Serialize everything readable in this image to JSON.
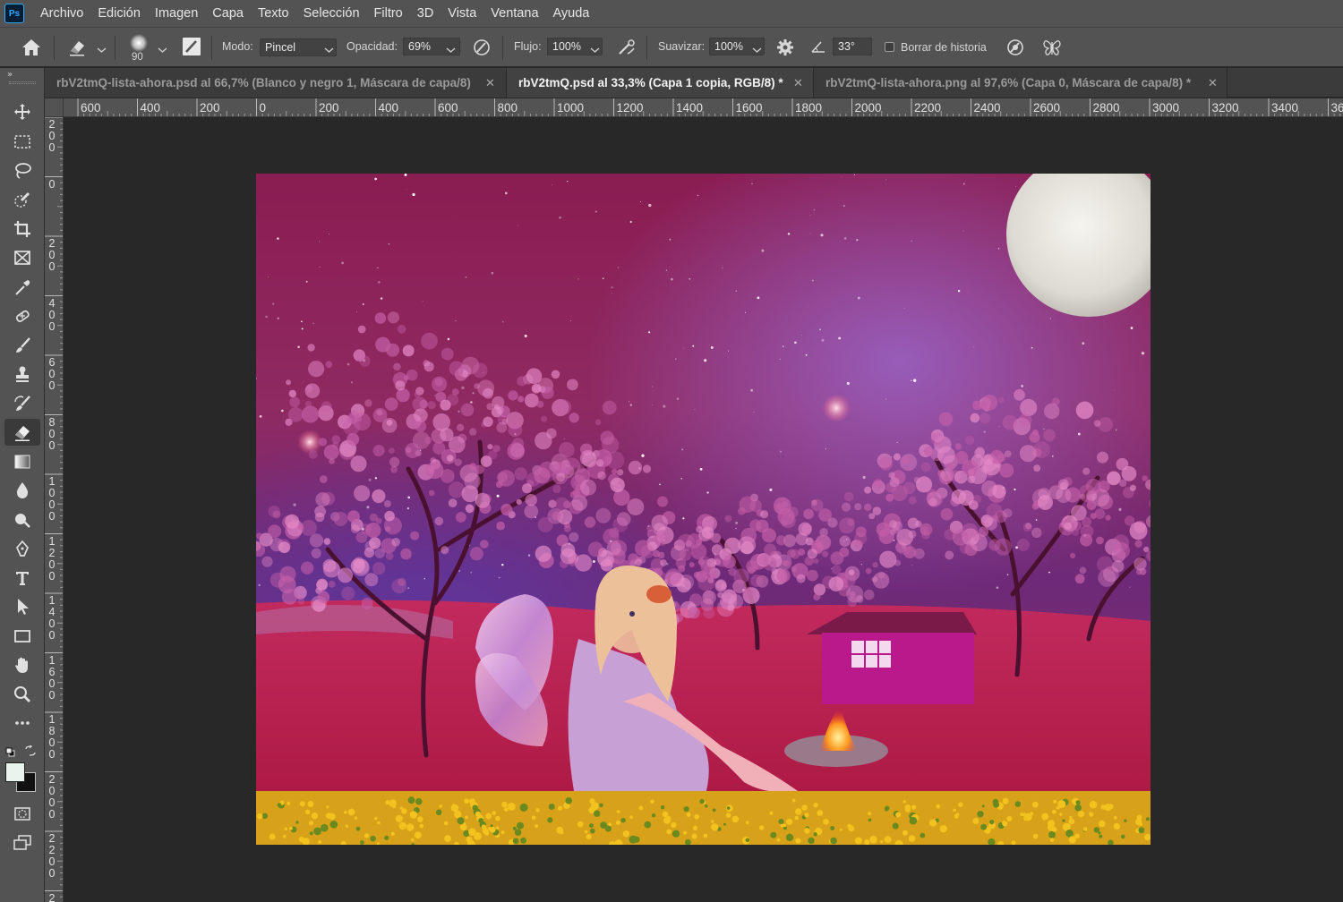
{
  "app": {
    "logo": "Ps"
  },
  "menu": [
    "Archivo",
    "Edición",
    "Imagen",
    "Capa",
    "Texto",
    "Selección",
    "Filtro",
    "3D",
    "Vista",
    "Ventana",
    "Ayuda"
  ],
  "options": {
    "brush_size": "90",
    "mode_label": "Modo:",
    "mode_value": "Pincel",
    "opacity_label": "Opacidad:",
    "opacity_value": "69%",
    "flow_label": "Flujo:",
    "flow_value": "100%",
    "smooth_label": "Suavizar:",
    "smooth_value": "100%",
    "angle_value": "33°",
    "erase_history_label": "Borrar de historia"
  },
  "tabs": [
    {
      "title": "rbV2tmQ-lista-ahora.psd al 66,7% (Blanco y negro 1, Máscara de capa/8)",
      "active": false
    },
    {
      "title": "rbV2tmQ.psd al 33,3% (Capa 1 copia, RGB/8) *",
      "active": true
    },
    {
      "title": "rbV2tmQ-lista-ahora.png al 97,6% (Capa 0, Máscara de capa/8) *",
      "active": false
    }
  ],
  "ruler_h": [
    "600",
    "400",
    "200",
    "0",
    "200",
    "400",
    "600",
    "800",
    "1000",
    "1200",
    "1400",
    "1600",
    "1800",
    "2000",
    "2200",
    "2400",
    "2600",
    "2800",
    "3000",
    "3200",
    "3400",
    "36"
  ],
  "ruler_v": [
    "200",
    "0",
    "200",
    "400",
    "600",
    "800",
    "1000",
    "1200",
    "1400",
    "1600",
    "1800",
    "2000",
    "2200",
    "2"
  ],
  "colors": {
    "foreground": "#eaf4ef",
    "background": "#111111",
    "accent": "#31a8ff"
  },
  "tools": [
    "move-tool",
    "marquee-tool",
    "lasso-tool",
    "quick-selection-tool",
    "crop-tool",
    "frame-tool",
    "eyedropper-tool",
    "spot-healing-tool",
    "brush-tool",
    "clone-stamp-tool",
    "history-brush-tool",
    "eraser-tool",
    "gradient-tool",
    "blur-tool",
    "dodge-tool",
    "pen-tool",
    "type-tool",
    "path-selection-tool",
    "rectangle-tool",
    "hand-tool",
    "zoom-tool",
    "more-tools"
  ]
}
